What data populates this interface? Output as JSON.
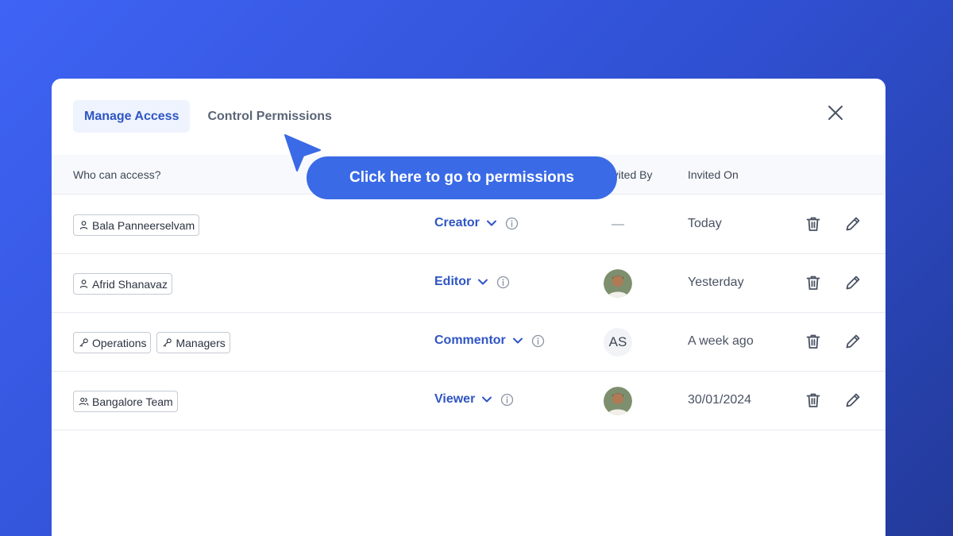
{
  "tabs": [
    {
      "label": "Manage Access",
      "active": true
    },
    {
      "label": "Control Permissions",
      "active": false
    }
  ],
  "table": {
    "headers": {
      "who": "Who can access?",
      "invited_by": "Invited By",
      "invited_on": "Invited On"
    },
    "rows": [
      {
        "chips": [
          {
            "label": "Bala Panneerselvam",
            "icon": "user-icon"
          }
        ],
        "role": "Creator",
        "invited_by": "—",
        "invited_on": "Today"
      },
      {
        "chips": [
          {
            "label": "Afrid Shanavaz",
            "icon": "user-icon"
          }
        ],
        "role": "Editor",
        "invited_by": "avatar-photo",
        "invited_on": "Yesterday"
      },
      {
        "chips": [
          {
            "label": "Operations",
            "icon": "key-icon"
          },
          {
            "label": "Managers",
            "icon": "key-icon"
          }
        ],
        "role": "Commentor",
        "invited_by": "AS",
        "invited_on": "A week ago"
      },
      {
        "chips": [
          {
            "label": "Bangalore Team",
            "icon": "users-icon"
          }
        ],
        "role": "Viewer",
        "invited_by": "avatar-photo",
        "invited_on": "30/01/2024"
      }
    ]
  },
  "callout": {
    "label": "Click here to go to permissions"
  },
  "colors": {
    "accent": "#2f55c5",
    "callout": "#3a6ae6",
    "background": "#3f63f5"
  }
}
